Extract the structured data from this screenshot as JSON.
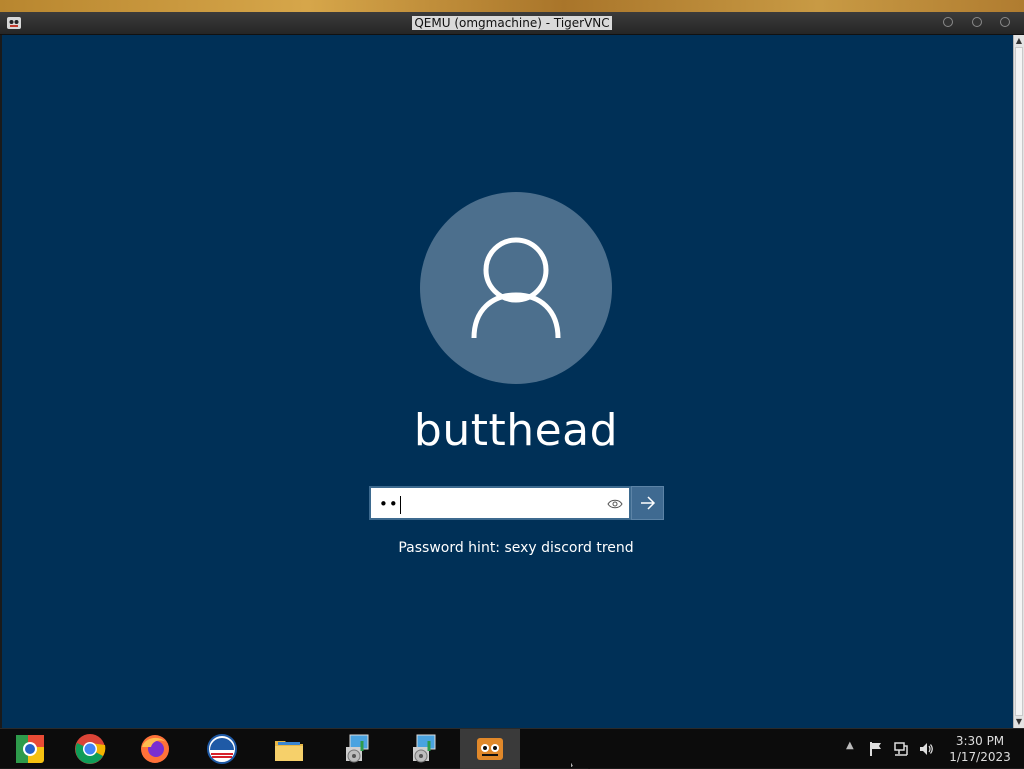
{
  "window": {
    "title": "QEMU (omgmachine) - TigerVNC"
  },
  "login": {
    "username": "butthead",
    "password_masked": "••",
    "password_hint": "Password hint: sexy discord trend"
  },
  "taskbar": {
    "apps": [
      {
        "name": "Chrome Canary"
      },
      {
        "name": "Google Chrome"
      },
      {
        "name": "Firefox"
      },
      {
        "name": "Obama"
      },
      {
        "name": "File Explorer"
      },
      {
        "name": "Setup installer"
      },
      {
        "name": "Setup installer"
      },
      {
        "name": "TigerVNC"
      }
    ],
    "clock_time": "3:30 PM",
    "clock_date": "1/17/2023"
  },
  "colors": {
    "lock_background": "#003057",
    "avatar": "#4c6f8d",
    "submit": "#3f6a91"
  }
}
